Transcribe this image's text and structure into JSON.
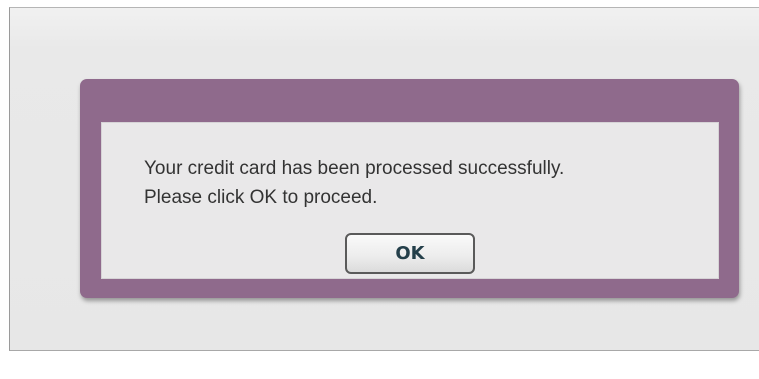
{
  "dialog": {
    "message_line1": "Your credit card has been processed successfully.",
    "message_line2": "Please click OK to proceed.",
    "ok_label": "OK"
  },
  "colors": {
    "dialog_border": "#8f6a8c",
    "dialog_body": "#e9e8e9",
    "window_background": "#e7e7e7",
    "button_text": "#243f4a"
  }
}
